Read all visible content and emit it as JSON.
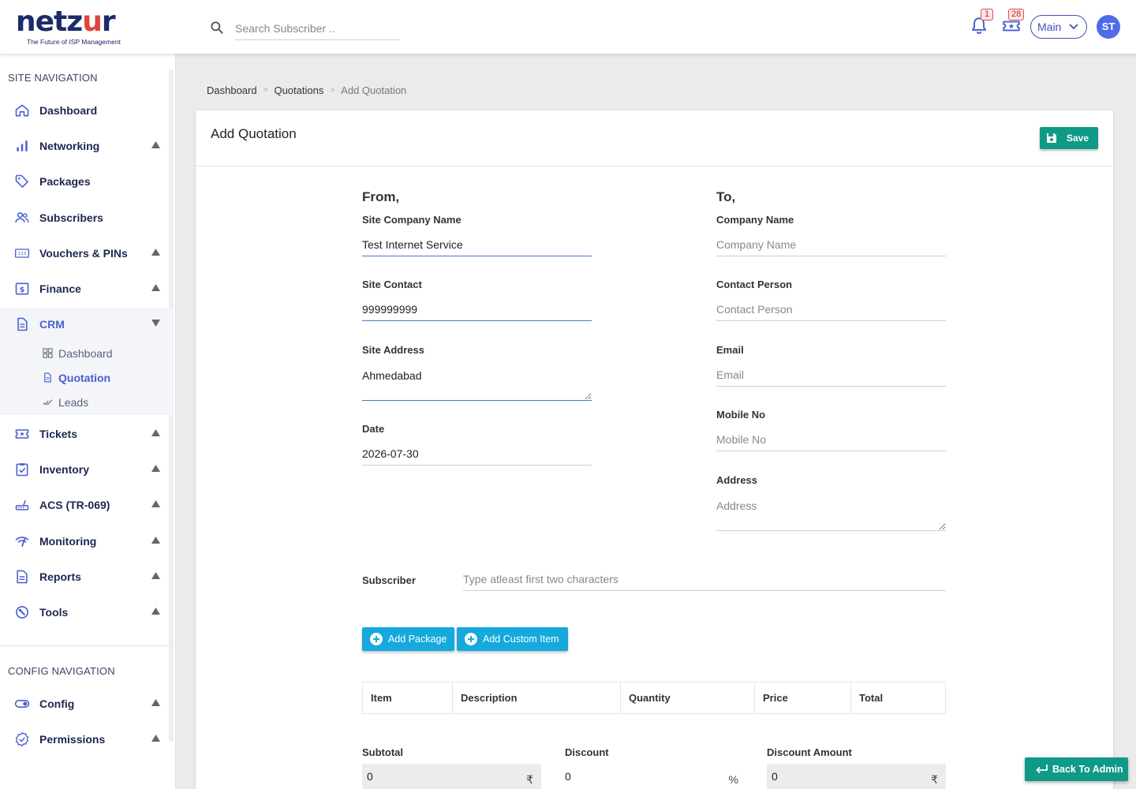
{
  "brand": {
    "logo_word_a": "netz",
    "logo_word_u": "u",
    "logo_word_b": "r",
    "tagline": "The Future of ISP Management"
  },
  "header": {
    "search_placeholder": "Search Subscriber ..",
    "notifications_count": "1",
    "tickets_count": "28",
    "site_select": "Main",
    "avatar_initials": "ST"
  },
  "sidebar": {
    "site_nav_title": "SITE NAVIGATION",
    "config_nav_title": "CONFIG NAVIGATION",
    "items": [
      {
        "label": "Dashboard",
        "icon": "home-icon"
      },
      {
        "label": "Networking",
        "icon": "bar-chart-icon"
      },
      {
        "label": "Packages",
        "icon": "tag-icon"
      },
      {
        "label": "Subscribers",
        "icon": "users-icon"
      },
      {
        "label": "Vouchers & PINs",
        "icon": "voucher-icon"
      },
      {
        "label": "Finance",
        "icon": "dollar-icon"
      },
      {
        "label": "CRM",
        "icon": "document-icon"
      },
      {
        "label": "Tickets",
        "icon": "ticket-icon"
      },
      {
        "label": "Inventory",
        "icon": "clipboard-check-icon"
      },
      {
        "label": "ACS (TR-069)",
        "icon": "router-icon"
      },
      {
        "label": "Monitoring",
        "icon": "signal-icon"
      },
      {
        "label": "Reports",
        "icon": "report-icon"
      },
      {
        "label": "Tools",
        "icon": "wrench-icon"
      }
    ],
    "crm_sub": [
      {
        "label": "Dashboard",
        "icon": "grid-icon"
      },
      {
        "label": "Quotation",
        "icon": "file-icon"
      },
      {
        "label": "Leads",
        "icon": "double-check-icon"
      }
    ],
    "config_items": [
      {
        "label": "Config",
        "icon": "toggle-icon"
      },
      {
        "label": "Permissions",
        "icon": "badge-check-icon"
      }
    ]
  },
  "breadcrumb": {
    "items": [
      "Dashboard",
      "Quotations",
      "Add Quotation"
    ]
  },
  "page": {
    "title": "Add Quotation",
    "save_label": "Save",
    "from_heading": "From,",
    "to_heading": "To,",
    "from": {
      "company_label": "Site Company Name",
      "company_value": "Test Internet Service",
      "contact_label": "Site Contact",
      "contact_value": "999999999",
      "address_label": "Site Address",
      "address_value": "Ahmedabad",
      "date_label": "Date",
      "date_value": "2026-07-30"
    },
    "to": {
      "company_label": "Company Name",
      "company_placeholder": "Company Name",
      "person_label": "Contact Person",
      "person_placeholder": "Contact Person",
      "email_label": "Email",
      "email_placeholder": "Email",
      "mobile_label": "Mobile No",
      "mobile_placeholder": "Mobile No",
      "address_label": "Address",
      "address_placeholder": "Address"
    },
    "subscriber_label": "Subscriber",
    "subscriber_placeholder": "Type atleast first two characters",
    "add_package_label": "Add Package",
    "add_custom_label": "Add Custom Item",
    "table_headers": [
      "Item",
      "Description",
      "Quantity",
      "Price",
      "Total"
    ],
    "subtotal_label": "Subtotal",
    "subtotal_value": "0",
    "discount_label": "Discount",
    "discount_value": "0",
    "discount_amount_label": "Discount Amount",
    "discount_amount_value": "0",
    "currency_symbol": "₹",
    "percent_symbol": "%"
  },
  "back_label": "Back To Admin",
  "colors": {
    "brand_navy": "#1d2a6b",
    "accent_blue": "#4a5fd0",
    "save_green": "#0f9a87",
    "add_blue": "#15a9dd"
  }
}
